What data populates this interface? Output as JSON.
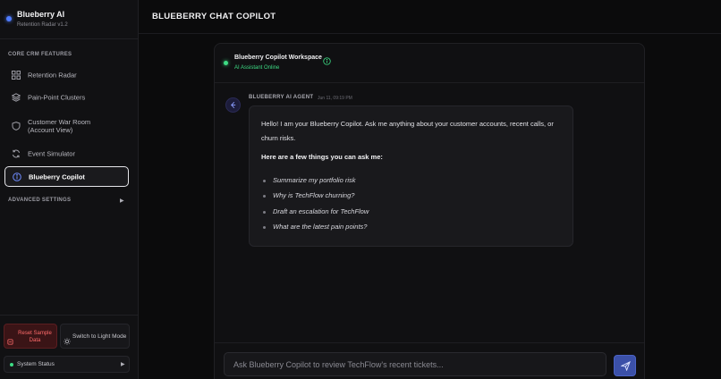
{
  "brand": {
    "title": "Blueberry AI",
    "subtitle": "Retention Radar v1.2"
  },
  "sidebar": {
    "section_core": "CORE CRM FEATURES",
    "items": [
      {
        "label": "Retention Radar",
        "icon": "grid-icon",
        "active": false
      },
      {
        "label": "Pain-Point Clusters",
        "icon": "layers-icon",
        "active": false
      },
      {
        "label": "Customer War Room (Account View)",
        "icon": "shield-icon",
        "active": false
      },
      {
        "label": "Event Simulator",
        "icon": "refresh-icon",
        "active": false
      },
      {
        "label": "Blueberry Copilot",
        "icon": "info-icon",
        "active": true
      }
    ],
    "section_advanced": "ADVANCED SETTINGS",
    "advanced_arrow": "▶",
    "footer": {
      "reset_label": "Reset Sample Data",
      "theme_label": "Switch to Light Mode",
      "status_label": "System Status",
      "status_arrow": "▶"
    }
  },
  "header": {
    "title": "BLUEBERRY CHAT COPILOT"
  },
  "workspace": {
    "title": "Blueberry Copilot Workspace",
    "status": "AI Assistant Online"
  },
  "message": {
    "author": "BLUEBERRY AI AGENT",
    "time": "Jun 11, 09:19 PM",
    "intro": "Hello! I am your Blueberry Copilot. Ask me anything about your customer accounts, recent calls, or churn risks.",
    "heading": "Here are a few things you can ask me:",
    "suggestions": [
      "Summarize my portfolio risk",
      "Why is TechFlow churning?",
      "Draft an escalation for TechFlow",
      "What are the latest pain points?"
    ]
  },
  "input": {
    "placeholder": "Ask Blueberry Copilot to review TechFlow's recent tickets...",
    "value": ""
  },
  "colors": {
    "accent": "#4f7cff",
    "online": "#3ddc84",
    "danger": "#ff6b6b",
    "send_button": "#3b50a8"
  }
}
